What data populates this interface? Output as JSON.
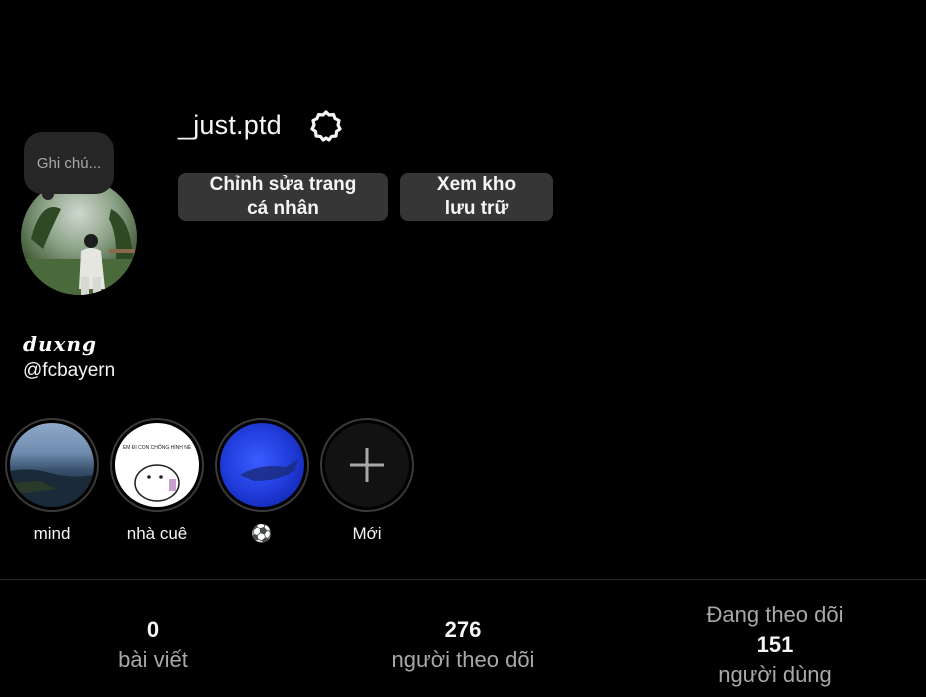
{
  "profile": {
    "username": "_just.ptd",
    "display_name": "duxng",
    "handle": "@fcbayern",
    "note_placeholder": "Ghi chú...",
    "avatar_icon": "avatar-photo"
  },
  "actions": {
    "edit_profile": "Chỉnh sửa trang cá nhân",
    "view_archive": "Xem kho lưu trữ",
    "settings_icon": "gear-icon"
  },
  "highlights": [
    {
      "label": "mind",
      "image_text": ""
    },
    {
      "label": "nhà cuê",
      "image_text": "EM ĐI CON CHỐNG HÌNH NÈ"
    },
    {
      "label": "⚽",
      "image_text": ""
    },
    {
      "label": "Mới",
      "image_text": ""
    }
  ],
  "stats": {
    "posts": {
      "value": "0",
      "label": "bài viết"
    },
    "followers": {
      "value": "276",
      "label": "người theo dõi"
    },
    "following": {
      "prefix": "Đang theo dõi",
      "value": "151",
      "label": "người dùng"
    }
  },
  "colors": {
    "background": "#000000",
    "button_bg": "#363636",
    "secondary_text": "#a8a8a8",
    "divider": "#262626"
  }
}
